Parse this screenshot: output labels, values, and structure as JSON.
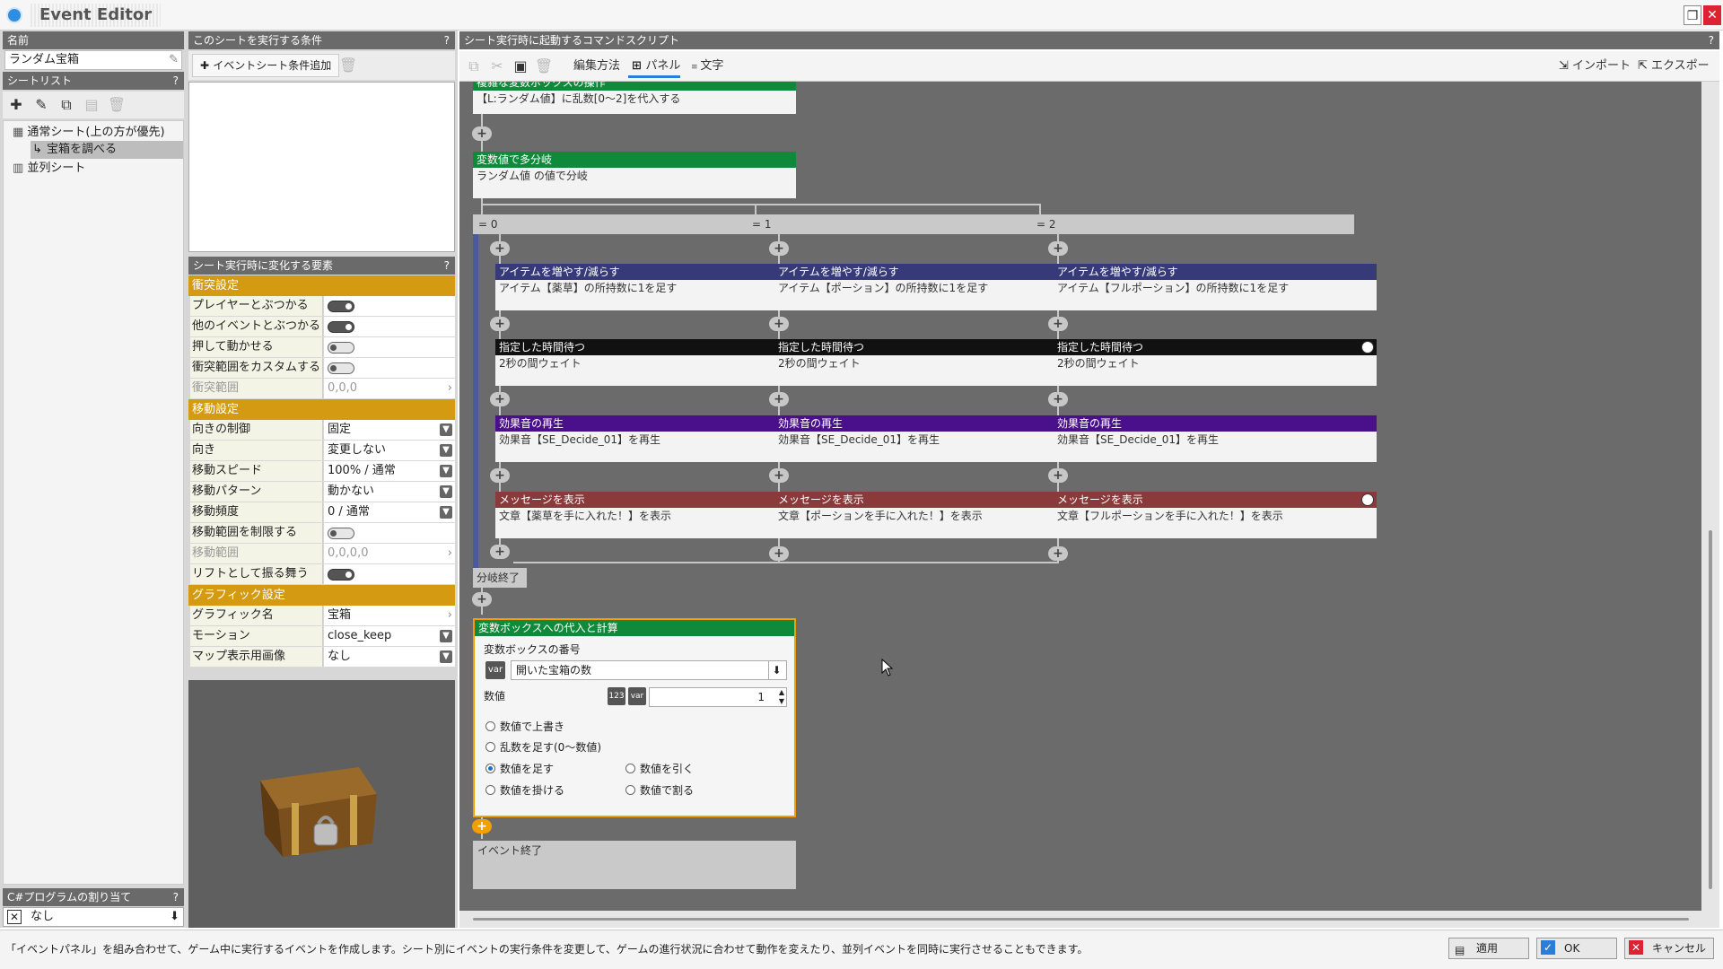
{
  "window": {
    "title": "Event Editor"
  },
  "left": {
    "name_header": "名前",
    "name_value": "ランダム宝箱",
    "sheetlist_header": "シートリスト",
    "tree": [
      {
        "label": "通常シート(上の方が優先)"
      },
      {
        "label": "宝箱を調べる"
      },
      {
        "label": "並列シート"
      }
    ],
    "csharp_header": "C#プログラムの割り当て",
    "csharp_value": "なし",
    "help": "?"
  },
  "conditions": {
    "header": "このシートを実行する条件",
    "add_label": "イベントシート条件追加"
  },
  "props": {
    "header": "シート実行時に変化する要素",
    "collision_title": "衝突設定",
    "movement_title": "移動設定",
    "graphic_title": "グラフィック設定",
    "rows": [
      {
        "label": "プレイヤーとぶつかる",
        "value": ""
      },
      {
        "label": "他のイベントとぶつかる",
        "value": ""
      },
      {
        "label": "押して動かせる",
        "value": ""
      },
      {
        "label": "衝突範囲をカスタムする",
        "value": ""
      },
      {
        "label": "衝突範囲",
        "value": "0,0,0"
      },
      {
        "label": "向きの制御",
        "value": "固定"
      },
      {
        "label": "向き",
        "value": "変更しない"
      },
      {
        "label": "移動スピード",
        "value": "100% / 通常"
      },
      {
        "label": "移動パターン",
        "value": "動かない"
      },
      {
        "label": "移動頻度",
        "value": "0 / 通常"
      },
      {
        "label": "移動範囲を制限する",
        "value": ""
      },
      {
        "label": "移動範囲",
        "value": "0,0,0,0"
      },
      {
        "label": "リフトとして振る舞う",
        "value": ""
      },
      {
        "label": "グラフィック名",
        "value": "宝箱"
      },
      {
        "label": "モーション",
        "value": "close_keep"
      },
      {
        "label": "マップ表示用画像",
        "value": "なし"
      }
    ]
  },
  "script": {
    "header": "シート実行時に起動するコマンドスクリプト",
    "edit_mode_label": "編集方法",
    "panel_label": "パネル",
    "text_label": "文字",
    "import_label": "インポート",
    "export_label": "エクスポート",
    "top_cmd": {
      "title": "複雑な変数ボックスの操作",
      "body": "【L:ランダム値】に乱数[0〜2]を代入する"
    },
    "switch_cmd": {
      "title": "変数値で多分岐",
      "body": "ランダム値 の値で分岐"
    },
    "branches": [
      {
        "label": "= 0",
        "item_title": "アイテムを増やす/減らす",
        "item_body": "アイテム【薬草】の所持数に1を足す",
        "wait_title": "指定した時間待つ",
        "wait_body": "2秒の間ウェイト",
        "se_title": "効果音の再生",
        "se_body": "効果音【SE_Decide_01】を再生",
        "msg_title": "メッセージを表示",
        "msg_body": "文章【薬草を手に入れた！】を表示"
      },
      {
        "label": "= 1",
        "item_title": "アイテムを増やす/減らす",
        "item_body": "アイテム【ポーション】の所持数に1を足す",
        "wait_title": "指定した時間待つ",
        "wait_body": "2秒の間ウェイト",
        "se_title": "効果音の再生",
        "se_body": "効果音【SE_Decide_01】を再生",
        "msg_title": "メッセージを表示",
        "msg_body": "文章【ポーションを手に入れた！】を表示"
      },
      {
        "label": "= 2",
        "item_title": "アイテムを増やす/減らす",
        "item_body": "アイテム【フルポーション】の所持数に1を足す",
        "wait_title": "指定した時間待つ",
        "wait_body": "2秒の間ウェイト",
        "se_title": "効果音の再生",
        "se_body": "効果音【SE_Decide_01】を再生",
        "msg_title": "メッセージを表示",
        "msg_body": "文章【フルポーションを手に入れた！】を表示"
      }
    ],
    "branch_end": "分岐終了",
    "var_panel": {
      "title": "変数ボックスへの代入と計算",
      "number_label": "変数ボックスの番号",
      "var_value": "開いた宝箱の数",
      "numeric_label": "数値",
      "numeric_value": "1",
      "options": [
        "数値で上書き",
        "乱数を足す(0〜数値)",
        "数値を足す",
        "数値を引く",
        "数値を掛ける",
        "数値で割る"
      ],
      "selected": "数値を足す"
    },
    "event_end": "イベント終了"
  },
  "footer": {
    "status": "「イベントパネル」を組み合わせて、ゲーム中に実行するイベントを作成します。シート別にイベントの実行条件を変更して、ゲームの進行状況に合わせて動作を変えたり、並列イベントを同時に実行させることもできます。",
    "apply": "適用",
    "ok": "OK",
    "cancel": "キャンセル"
  },
  "colors": {
    "green": "#0e8a3a",
    "navy": "#363a78",
    "black": "#111111",
    "purple": "#4a0f8a",
    "maroon": "#8a3a3a",
    "orange": "#d49a12",
    "accent": "#f0a000"
  }
}
